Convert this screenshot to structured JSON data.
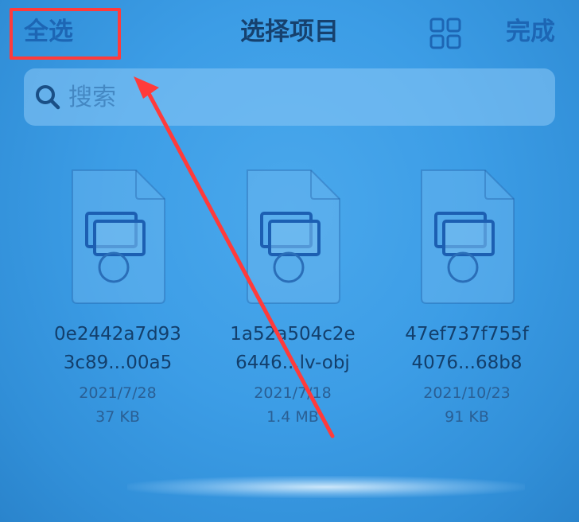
{
  "header": {
    "select_all": "全选",
    "title": "选择项目",
    "done": "完成"
  },
  "search": {
    "placeholder": "搜索"
  },
  "files": [
    {
      "name_line1": "0e2442a7d93",
      "name_line2": "3c89...00a5",
      "date": "2021/7/28",
      "size": "37 KB"
    },
    {
      "name_line1": "1a52a504c2e",
      "name_line2": "6446...lv-obj",
      "date": "2021/7/18",
      "size": "1.4 MB"
    },
    {
      "name_line1": "47ef737f755f",
      "name_line2": "4076...68b8",
      "date": "2021/10/23",
      "size": "91 KB"
    }
  ],
  "icons": {
    "grid": "grid-view-icon",
    "search": "search-icon",
    "file": "media-file-icon",
    "annotation": "red-arrow"
  },
  "colors": {
    "accent": "#1d66b4",
    "annotation": "#ff3b3b",
    "background": "#3c9de6"
  }
}
